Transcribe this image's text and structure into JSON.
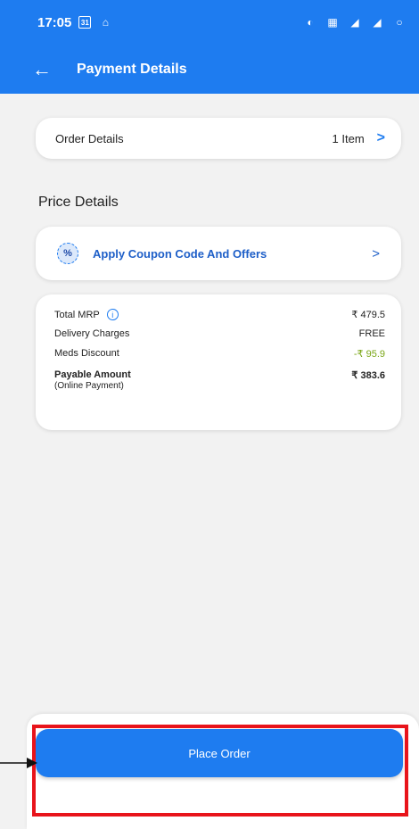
{
  "status_bar": {
    "time": "17:05",
    "cal_badge": "31"
  },
  "app_bar": {
    "title": "Payment Details"
  },
  "order_details": {
    "label": "Order Details",
    "count": "1 Item"
  },
  "price_section": {
    "title": "Price Details"
  },
  "coupon": {
    "icon_text": "%",
    "label": "Apply Coupon Code And Offers"
  },
  "price_rows": {
    "total_mrp": {
      "label": "Total MRP",
      "value": "₹ 479.5"
    },
    "delivery": {
      "label": "Delivery Charges",
      "value": "FREE"
    },
    "discount": {
      "label": "Meds Discount",
      "value": "-₹ 95.9"
    },
    "payable": {
      "label": "Payable Amount",
      "sub": "(Online Payment)",
      "value": "₹ 383.6"
    }
  },
  "place_order": {
    "label": "Place Order"
  },
  "colors": {
    "primary": "#1e7cf0",
    "discount": "#7aa616",
    "highlight": "#e8141b"
  },
  "icons": [
    "back-arrow-icon",
    "chevron-right-icon",
    "info-icon",
    "coupon-percent-icon",
    "annotation-arrow-icon"
  ]
}
